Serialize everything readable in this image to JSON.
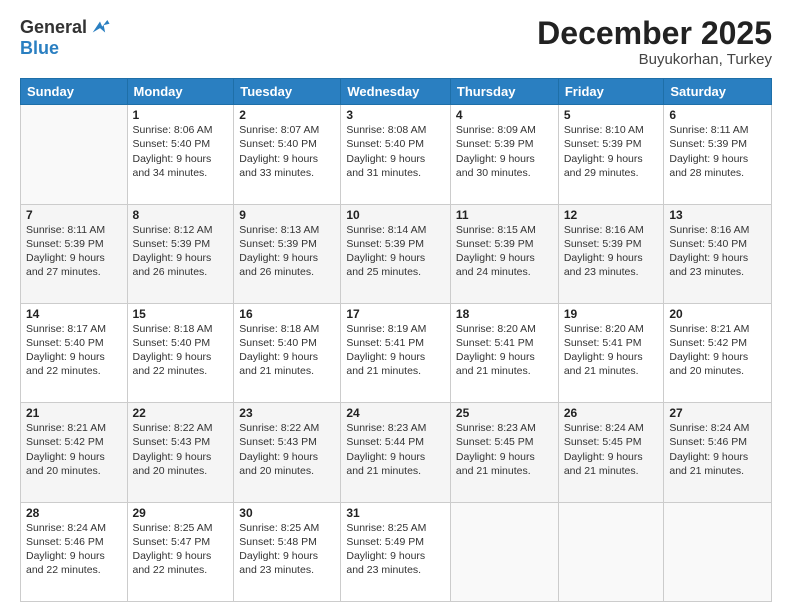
{
  "logo": {
    "general": "General",
    "blue": "Blue"
  },
  "title": "December 2025",
  "location": "Buyukorhan, Turkey",
  "days": [
    "Sunday",
    "Monday",
    "Tuesday",
    "Wednesday",
    "Thursday",
    "Friday",
    "Saturday"
  ],
  "weeks": [
    [
      {
        "day": "",
        "sunrise": "",
        "sunset": "",
        "daylight": ""
      },
      {
        "day": "1",
        "sunrise": "Sunrise: 8:06 AM",
        "sunset": "Sunset: 5:40 PM",
        "daylight": "Daylight: 9 hours and 34 minutes."
      },
      {
        "day": "2",
        "sunrise": "Sunrise: 8:07 AM",
        "sunset": "Sunset: 5:40 PM",
        "daylight": "Daylight: 9 hours and 33 minutes."
      },
      {
        "day": "3",
        "sunrise": "Sunrise: 8:08 AM",
        "sunset": "Sunset: 5:40 PM",
        "daylight": "Daylight: 9 hours and 31 minutes."
      },
      {
        "day": "4",
        "sunrise": "Sunrise: 8:09 AM",
        "sunset": "Sunset: 5:39 PM",
        "daylight": "Daylight: 9 hours and 30 minutes."
      },
      {
        "day": "5",
        "sunrise": "Sunrise: 8:10 AM",
        "sunset": "Sunset: 5:39 PM",
        "daylight": "Daylight: 9 hours and 29 minutes."
      },
      {
        "day": "6",
        "sunrise": "Sunrise: 8:11 AM",
        "sunset": "Sunset: 5:39 PM",
        "daylight": "Daylight: 9 hours and 28 minutes."
      }
    ],
    [
      {
        "day": "7",
        "sunrise": "Sunrise: 8:11 AM",
        "sunset": "Sunset: 5:39 PM",
        "daylight": "Daylight: 9 hours and 27 minutes."
      },
      {
        "day": "8",
        "sunrise": "Sunrise: 8:12 AM",
        "sunset": "Sunset: 5:39 PM",
        "daylight": "Daylight: 9 hours and 26 minutes."
      },
      {
        "day": "9",
        "sunrise": "Sunrise: 8:13 AM",
        "sunset": "Sunset: 5:39 PM",
        "daylight": "Daylight: 9 hours and 26 minutes."
      },
      {
        "day": "10",
        "sunrise": "Sunrise: 8:14 AM",
        "sunset": "Sunset: 5:39 PM",
        "daylight": "Daylight: 9 hours and 25 minutes."
      },
      {
        "day": "11",
        "sunrise": "Sunrise: 8:15 AM",
        "sunset": "Sunset: 5:39 PM",
        "daylight": "Daylight: 9 hours and 24 minutes."
      },
      {
        "day": "12",
        "sunrise": "Sunrise: 8:16 AM",
        "sunset": "Sunset: 5:39 PM",
        "daylight": "Daylight: 9 hours and 23 minutes."
      },
      {
        "day": "13",
        "sunrise": "Sunrise: 8:16 AM",
        "sunset": "Sunset: 5:40 PM",
        "daylight": "Daylight: 9 hours and 23 minutes."
      }
    ],
    [
      {
        "day": "14",
        "sunrise": "Sunrise: 8:17 AM",
        "sunset": "Sunset: 5:40 PM",
        "daylight": "Daylight: 9 hours and 22 minutes."
      },
      {
        "day": "15",
        "sunrise": "Sunrise: 8:18 AM",
        "sunset": "Sunset: 5:40 PM",
        "daylight": "Daylight: 9 hours and 22 minutes."
      },
      {
        "day": "16",
        "sunrise": "Sunrise: 8:18 AM",
        "sunset": "Sunset: 5:40 PM",
        "daylight": "Daylight: 9 hours and 21 minutes."
      },
      {
        "day": "17",
        "sunrise": "Sunrise: 8:19 AM",
        "sunset": "Sunset: 5:41 PM",
        "daylight": "Daylight: 9 hours and 21 minutes."
      },
      {
        "day": "18",
        "sunrise": "Sunrise: 8:20 AM",
        "sunset": "Sunset: 5:41 PM",
        "daylight": "Daylight: 9 hours and 21 minutes."
      },
      {
        "day": "19",
        "sunrise": "Sunrise: 8:20 AM",
        "sunset": "Sunset: 5:41 PM",
        "daylight": "Daylight: 9 hours and 21 minutes."
      },
      {
        "day": "20",
        "sunrise": "Sunrise: 8:21 AM",
        "sunset": "Sunset: 5:42 PM",
        "daylight": "Daylight: 9 hours and 20 minutes."
      }
    ],
    [
      {
        "day": "21",
        "sunrise": "Sunrise: 8:21 AM",
        "sunset": "Sunset: 5:42 PM",
        "daylight": "Daylight: 9 hours and 20 minutes."
      },
      {
        "day": "22",
        "sunrise": "Sunrise: 8:22 AM",
        "sunset": "Sunset: 5:43 PM",
        "daylight": "Daylight: 9 hours and 20 minutes."
      },
      {
        "day": "23",
        "sunrise": "Sunrise: 8:22 AM",
        "sunset": "Sunset: 5:43 PM",
        "daylight": "Daylight: 9 hours and 20 minutes."
      },
      {
        "day": "24",
        "sunrise": "Sunrise: 8:23 AM",
        "sunset": "Sunset: 5:44 PM",
        "daylight": "Daylight: 9 hours and 21 minutes."
      },
      {
        "day": "25",
        "sunrise": "Sunrise: 8:23 AM",
        "sunset": "Sunset: 5:45 PM",
        "daylight": "Daylight: 9 hours and 21 minutes."
      },
      {
        "day": "26",
        "sunrise": "Sunrise: 8:24 AM",
        "sunset": "Sunset: 5:45 PM",
        "daylight": "Daylight: 9 hours and 21 minutes."
      },
      {
        "day": "27",
        "sunrise": "Sunrise: 8:24 AM",
        "sunset": "Sunset: 5:46 PM",
        "daylight": "Daylight: 9 hours and 21 minutes."
      }
    ],
    [
      {
        "day": "28",
        "sunrise": "Sunrise: 8:24 AM",
        "sunset": "Sunset: 5:46 PM",
        "daylight": "Daylight: 9 hours and 22 minutes."
      },
      {
        "day": "29",
        "sunrise": "Sunrise: 8:25 AM",
        "sunset": "Sunset: 5:47 PM",
        "daylight": "Daylight: 9 hours and 22 minutes."
      },
      {
        "day": "30",
        "sunrise": "Sunrise: 8:25 AM",
        "sunset": "Sunset: 5:48 PM",
        "daylight": "Daylight: 9 hours and 23 minutes."
      },
      {
        "day": "31",
        "sunrise": "Sunrise: 8:25 AM",
        "sunset": "Sunset: 5:49 PM",
        "daylight": "Daylight: 9 hours and 23 minutes."
      },
      {
        "day": "",
        "sunrise": "",
        "sunset": "",
        "daylight": ""
      },
      {
        "day": "",
        "sunrise": "",
        "sunset": "",
        "daylight": ""
      },
      {
        "day": "",
        "sunrise": "",
        "sunset": "",
        "daylight": ""
      }
    ]
  ]
}
